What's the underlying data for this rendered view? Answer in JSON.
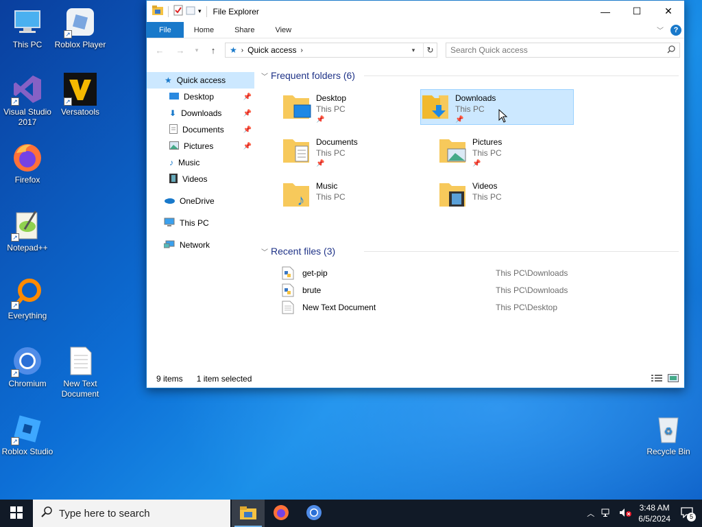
{
  "desktop": {
    "icons": [
      {
        "label": "This PC",
        "icon": "this-pc-icon"
      },
      {
        "label": "Roblox Player",
        "icon": "roblox-player-icon"
      },
      {
        "label": "Visual Studio 2017",
        "icon": "visual-studio-icon"
      },
      {
        "label": "Versatools",
        "icon": "versatools-icon"
      },
      {
        "label": "Firefox",
        "icon": "firefox-icon"
      },
      {
        "label": "Notepad++",
        "icon": "notepadpp-icon"
      },
      {
        "label": "Everything",
        "icon": "everything-icon"
      },
      {
        "label": "Chromium",
        "icon": "chromium-icon"
      },
      {
        "label": "New Text Document",
        "icon": "text-document-icon"
      },
      {
        "label": "Roblox Studio",
        "icon": "roblox-studio-icon"
      },
      {
        "label": "Recycle Bin",
        "icon": "recycle-bin-icon"
      }
    ]
  },
  "window": {
    "title": "File Explorer",
    "ribbon_tabs": [
      "File",
      "Home",
      "Share",
      "View"
    ],
    "address": "Quick access",
    "search_placeholder": "Search Quick access"
  },
  "nav_pane": {
    "items": [
      {
        "label": "Quick access",
        "icon": "star-icon"
      },
      {
        "label": "Desktop",
        "icon": "desktop-icon",
        "pinned": true
      },
      {
        "label": "Downloads",
        "icon": "downloads-icon",
        "pinned": true
      },
      {
        "label": "Documents",
        "icon": "documents-icon",
        "pinned": true
      },
      {
        "label": "Pictures",
        "icon": "pictures-icon",
        "pinned": true
      },
      {
        "label": "Music",
        "icon": "music-icon"
      },
      {
        "label": "Videos",
        "icon": "videos-icon"
      },
      {
        "label": "OneDrive",
        "icon": "onedrive-icon"
      },
      {
        "label": "This PC",
        "icon": "this-pc-icon"
      },
      {
        "label": "Network",
        "icon": "network-icon"
      }
    ]
  },
  "frequent": {
    "heading": "Frequent folders (6)",
    "folders": [
      {
        "name": "Desktop",
        "location": "This PC",
        "pinned": true
      },
      {
        "name": "Downloads",
        "location": "This PC",
        "pinned": true,
        "selected": true
      },
      {
        "name": "Documents",
        "location": "This PC",
        "pinned": true
      },
      {
        "name": "Pictures",
        "location": "This PC",
        "pinned": true
      },
      {
        "name": "Music",
        "location": "This PC"
      },
      {
        "name": "Videos",
        "location": "This PC"
      }
    ]
  },
  "recent": {
    "heading": "Recent files (3)",
    "files": [
      {
        "name": "get-pip",
        "path": "This PC\\Downloads",
        "icon": "python-file-icon"
      },
      {
        "name": "brute",
        "path": "This PC\\Downloads",
        "icon": "python-file-icon"
      },
      {
        "name": "New Text Document",
        "path": "This PC\\Desktop",
        "icon": "text-file-icon"
      }
    ]
  },
  "status": {
    "items": "9 items",
    "selected": "1 item selected"
  },
  "taskbar": {
    "search_placeholder": "Type here to search",
    "time": "3:48 AM",
    "date": "6/5/2024",
    "notifications": "5",
    "accent": "#76b9ed"
  }
}
